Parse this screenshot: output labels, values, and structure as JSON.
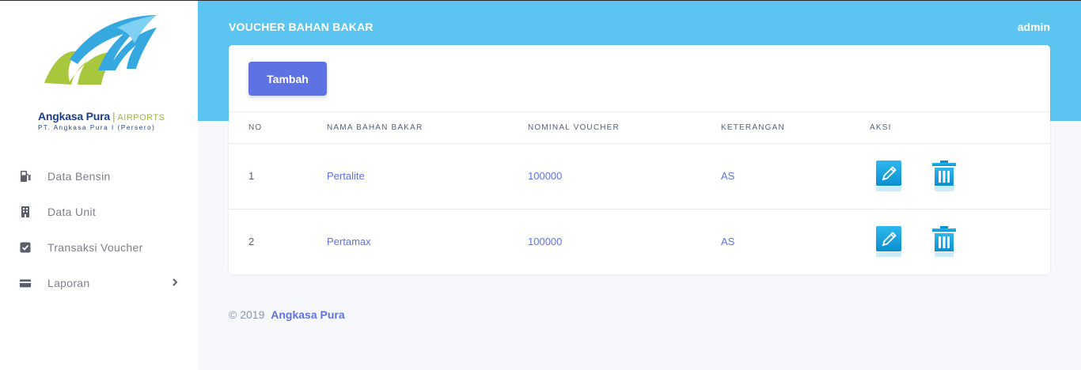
{
  "brand": {
    "name": "Angkasa Pura",
    "separator": "|",
    "airports": "AIRPORTS",
    "subtitle": "PT. Angkasa Pura I (Persero)",
    "colors": {
      "primary": "#1b3f8f",
      "green": "#9fb83a",
      "blue": "#35a8e0"
    }
  },
  "sidebar": {
    "items": [
      {
        "label": "Data Bensin",
        "icon": "gas-pump-icon"
      },
      {
        "label": "Data Unit",
        "icon": "building-icon"
      },
      {
        "label": "Transaksi Voucher",
        "icon": "checkbox-icon"
      },
      {
        "label": "Laporan",
        "icon": "credit-card-icon",
        "has_submenu": true
      }
    ]
  },
  "header": {
    "title": "VOUCHER BAHAN BAKAR",
    "user": "admin",
    "color": "#5bc4f0"
  },
  "actions": {
    "add_label": "Tambah",
    "accent": "#5e72e4"
  },
  "table": {
    "columns": [
      "NO",
      "NAMA BAHAN BAKAR",
      "NOMINAL VOUCHER",
      "KETERANGAN",
      "AKSI"
    ],
    "rows": [
      {
        "no": "1",
        "nama": "Pertalite",
        "nominal": "100000",
        "keterangan": "AS"
      },
      {
        "no": "2",
        "nama": "Pertamax",
        "nominal": "100000",
        "keterangan": "AS"
      }
    ],
    "row_actions": [
      "edit-icon",
      "trash-icon"
    ]
  },
  "footer": {
    "copyright": "© 2019",
    "brand": "Angkasa Pura"
  }
}
